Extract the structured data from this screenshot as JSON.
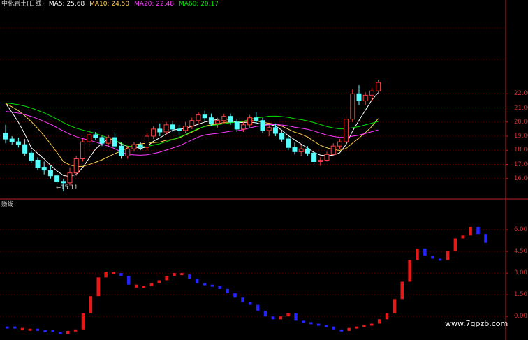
{
  "header": {
    "title": "中化岩土(日线)",
    "ma5": "MA5: 25.68",
    "ma10": "MA10: 24.50",
    "ma20": "MA20: 22.48",
    "ma60": "MA60: 20.17"
  },
  "indicator_label": "赚线",
  "low_marker": "←15.11",
  "watermark": "www.7gpzb.com",
  "colors": {
    "up": "#ff4040",
    "down": "#54ffff",
    "ma5": "#ffffff",
    "ma10": "#ffd24c",
    "ma20": "#ff3cff",
    "ma60": "#00e000",
    "axis": "#c02020",
    "ind_up": "#e81818",
    "ind_down": "#2424ff"
  },
  "chart_data": [
    {
      "type": "candlestick",
      "name": "price",
      "y_ticks": [
        "22.00",
        "21.00",
        "20.00",
        "19.00",
        "18.00",
        "17.00",
        "16.00"
      ],
      "ylim": [
        15.0,
        23.2
      ],
      "candles": [
        [
          19.2,
          19.8,
          18.5,
          18.8
        ],
        [
          18.8,
          19.0,
          18.4,
          18.6
        ],
        [
          18.6,
          18.9,
          18.2,
          18.4
        ],
        [
          18.4,
          18.8,
          17.6,
          17.8
        ],
        [
          17.8,
          18.0,
          17.1,
          17.3
        ],
        [
          17.3,
          17.5,
          16.6,
          16.8
        ],
        [
          16.8,
          17.2,
          16.3,
          16.6
        ],
        [
          16.6,
          16.9,
          16.0,
          16.2
        ],
        [
          16.2,
          16.3,
          15.6,
          15.8
        ],
        [
          15.8,
          16.0,
          15.1,
          15.7
        ],
        [
          15.7,
          16.8,
          15.5,
          16.4
        ],
        [
          16.4,
          17.6,
          16.2,
          17.4
        ],
        [
          17.4,
          18.8,
          17.2,
          18.6
        ],
        [
          18.6,
          19.4,
          18.2,
          19.1
        ],
        [
          19.1,
          19.3,
          18.7,
          18.9
        ],
        [
          18.9,
          19.0,
          18.3,
          18.5
        ],
        [
          18.5,
          19.1,
          18.3,
          18.9
        ],
        [
          18.9,
          19.2,
          18.1,
          18.3
        ],
        [
          18.3,
          18.6,
          17.4,
          17.6
        ],
        [
          17.6,
          18.3,
          17.4,
          18.1
        ],
        [
          18.1,
          18.6,
          17.9,
          18.4
        ],
        [
          18.4,
          18.6,
          18.0,
          18.2
        ],
        [
          18.2,
          19.2,
          18.0,
          19.0
        ],
        [
          19.0,
          19.7,
          18.8,
          19.5
        ],
        [
          19.5,
          19.9,
          19.0,
          19.3
        ],
        [
          19.3,
          20.0,
          19.1,
          19.8
        ],
        [
          19.8,
          20.1,
          19.3,
          19.5
        ],
        [
          19.5,
          19.8,
          19.1,
          19.4
        ],
        [
          19.4,
          20.0,
          19.2,
          19.7
        ],
        [
          19.7,
          20.3,
          19.5,
          20.1
        ],
        [
          20.1,
          20.7,
          19.9,
          20.5
        ],
        [
          20.5,
          20.8,
          20.0,
          20.3
        ],
        [
          20.3,
          20.6,
          19.7,
          19.9
        ],
        [
          19.9,
          20.3,
          19.6,
          20.1
        ],
        [
          20.1,
          20.6,
          19.9,
          20.4
        ],
        [
          20.4,
          20.6,
          19.8,
          20.0
        ],
        [
          20.0,
          20.2,
          19.3,
          19.5
        ],
        [
          19.5,
          20.0,
          19.3,
          19.8
        ],
        [
          19.8,
          20.5,
          19.6,
          20.3
        ],
        [
          20.3,
          20.7,
          19.9,
          20.1
        ],
        [
          20.1,
          20.3,
          19.2,
          19.4
        ],
        [
          19.4,
          19.8,
          19.0,
          19.6
        ],
        [
          19.6,
          19.9,
          19.0,
          19.2
        ],
        [
          19.2,
          19.4,
          18.6,
          18.8
        ],
        [
          18.8,
          19.0,
          18.0,
          18.2
        ],
        [
          18.2,
          18.6,
          17.7,
          17.9
        ],
        [
          17.9,
          18.4,
          17.6,
          18.1
        ],
        [
          18.1,
          18.3,
          17.6,
          17.8
        ],
        [
          17.8,
          17.9,
          17.0,
          17.2
        ],
        [
          17.2,
          17.5,
          16.9,
          17.3
        ],
        [
          17.3,
          17.9,
          17.2,
          17.7
        ],
        [
          17.7,
          18.5,
          17.6,
          18.3
        ],
        [
          18.3,
          18.8,
          18.1,
          18.6
        ],
        [
          18.6,
          20.5,
          18.4,
          20.2
        ],
        [
          20.2,
          22.3,
          20.0,
          22.0
        ],
        [
          22.0,
          22.6,
          21.2,
          21.5
        ],
        [
          21.5,
          22.1,
          21.2,
          21.9
        ],
        [
          21.9,
          22.4,
          21.5,
          22.2
        ],
        [
          22.2,
          23.0,
          22.0,
          22.8
        ]
      ]
    },
    {
      "type": "bar",
      "name": "indicator",
      "y_ticks": [
        "6.00",
        "4.50",
        "3.00",
        "1.50",
        "0.00"
      ],
      "ylim": [
        -1.2,
        7.5
      ],
      "values": [
        -0.7,
        -0.8,
        -0.9,
        -0.85,
        -1.0,
        -0.95,
        -1.1,
        -1.2,
        -1.0,
        -0.9,
        0.2,
        1.4,
        2.7,
        3.1,
        3.0,
        2.8,
        2.2,
        2.0,
        2.1,
        2.3,
        2.5,
        2.8,
        3.0,
        2.9,
        2.6,
        2.3,
        2.2,
        2.1,
        1.9,
        1.6,
        1.3,
        1.0,
        0.8,
        0.4,
        0.0,
        -0.2,
        0.0,
        0.2,
        -0.3,
        -0.4,
        -0.5,
        -0.6,
        -0.7,
        -0.9,
        -1.0,
        -0.8,
        -0.7,
        -0.6,
        -0.5,
        -0.2,
        0.2,
        1.2,
        2.4,
        3.9,
        4.7,
        4.2,
        4.0,
        3.9,
        4.5,
        5.4,
        5.6,
        6.2,
        5.7,
        5.1
      ],
      "direction": [
        0,
        0,
        1,
        1,
        0,
        0,
        0,
        0,
        1,
        1,
        1,
        1,
        1,
        1,
        1,
        0,
        0,
        1,
        1,
        1,
        1,
        1,
        1,
        1,
        0,
        0,
        0,
        0,
        0,
        0,
        0,
        0,
        0,
        0,
        0,
        0,
        1,
        1,
        0,
        0,
        0,
        0,
        0,
        0,
        0,
        1,
        1,
        1,
        1,
        1,
        1,
        1,
        1,
        1,
        1,
        0,
        0,
        0,
        1,
        1,
        1,
        1,
        0,
        0
      ]
    }
  ]
}
